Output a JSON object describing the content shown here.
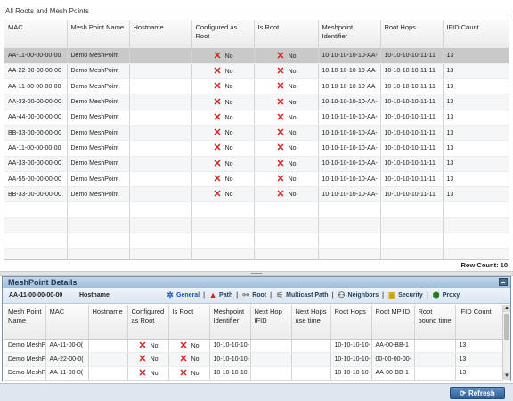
{
  "top": {
    "legend": "All Roots and Mesh Points",
    "columns": [
      "MAC",
      "Mesh Point Name",
      "Hostname",
      "Configured as Root",
      "Is Root",
      "Meshpoint Identifier",
      "Root Hops",
      "IFID Count"
    ],
    "rows": [
      {
        "mac": "AA-11-00-00-00-00",
        "name": "Demo MeshPoint",
        "host": "",
        "configured": "No",
        "is_root": "No",
        "meshpoint_id": "10-10-10-10-10-AA-",
        "root_hops": "10-10-10-10-11-11",
        "ifid": "13"
      },
      {
        "mac": "AA-22-00-00-00-00",
        "name": "Demo MeshPoint",
        "host": "",
        "configured": "No",
        "is_root": "No",
        "meshpoint_id": "10-10-10-10-10-AA-",
        "root_hops": "10-10-10-10-11-11",
        "ifid": "13"
      },
      {
        "mac": "AA-11-00-00-00-00",
        "name": "Demo MeshPoint",
        "host": "",
        "configured": "No",
        "is_root": "No",
        "meshpoint_id": "10-10-10-10-10-AA-",
        "root_hops": "10-10-10-10-11-11",
        "ifid": "13"
      },
      {
        "mac": "AA-33-00-00-00-00",
        "name": "Demo MeshPoint",
        "host": "",
        "configured": "No",
        "is_root": "No",
        "meshpoint_id": "10-10-10-10-10-AA-",
        "root_hops": "10-10-10-10-11-11",
        "ifid": "13"
      },
      {
        "mac": "AA-44-00-00-00-00",
        "name": "Demo MeshPoint",
        "host": "",
        "configured": "No",
        "is_root": "No",
        "meshpoint_id": "10-10-10-10-10-AA-",
        "root_hops": "10-10-10-10-11-11",
        "ifid": "13"
      },
      {
        "mac": "BB-33-00-00-00-00",
        "name": "Demo MeshPoint",
        "host": "",
        "configured": "No",
        "is_root": "No",
        "meshpoint_id": "10-10-10-10-10-AA-",
        "root_hops": "10-10-10-10-11-11",
        "ifid": "13"
      },
      {
        "mac": "AA-11-00-00-00-00",
        "name": "Demo MeshPoint",
        "host": "",
        "configured": "No",
        "is_root": "No",
        "meshpoint_id": "10-10-10-10-10-AA-",
        "root_hops": "10-10-10-10-11-11",
        "ifid": "13"
      },
      {
        "mac": "AA-33-00-00-00-00",
        "name": "Demo MeshPoint",
        "host": "",
        "configured": "No",
        "is_root": "No",
        "meshpoint_id": "10-10-10-10-10-AA-",
        "root_hops": "10-10-10-10-11-11",
        "ifid": "13"
      },
      {
        "mac": "AA-55-00-00-00-00",
        "name": "Demo MeshPoint",
        "host": "",
        "configured": "No",
        "is_root": "No",
        "meshpoint_id": "10-10-10-10-10-AA-",
        "root_hops": "10-10-10-10-11-11",
        "ifid": "13"
      },
      {
        "mac": "BB-33-00-00-00-00",
        "name": "Demo MeshPoint",
        "host": "",
        "configured": "No",
        "is_root": "No",
        "meshpoint_id": "10-10-10-10-10-AA-",
        "root_hops": "10-10-10-10-11-11",
        "ifid": "13"
      }
    ],
    "row_count": "Row Count: 10"
  },
  "details": {
    "title": "MeshPoint Details",
    "selected_mac": "AA-11-00-00-00-00",
    "hostname_label": "Hostname",
    "tabs": [
      {
        "label": "General",
        "icon": "general-icon"
      },
      {
        "label": "Path",
        "icon": "path-icon"
      },
      {
        "label": "Root",
        "icon": "root-icon"
      },
      {
        "label": "Multicast Path",
        "icon": "multicast-path-icon"
      },
      {
        "label": "Neighbors",
        "icon": "neighbors-icon"
      },
      {
        "label": "Security",
        "icon": "lock-icon"
      },
      {
        "label": "Proxy",
        "icon": "proxy-icon"
      }
    ],
    "columns": [
      "Mesh Point Name",
      "MAC",
      "Hostname",
      "Configured as Root",
      "Is Root",
      "Meshpoint Identifier",
      "Next Hop IFID",
      "Next Hops use time",
      "Root Hops",
      "Root MP ID",
      "Root bound time",
      "IFID Count"
    ],
    "rows": [
      {
        "name": "Demo MeshP",
        "mac": "AA-11-00-0(",
        "host": "",
        "configured": "No",
        "is_root": "No",
        "meshpoint_id": "10-10-10-10-",
        "next_hop": "",
        "next_time": "",
        "root_hops": "10-10-10-10-",
        "root_mp": "AA-00-BB-1",
        "bound": "",
        "ifid": "13"
      },
      {
        "name": "Demo MeshP",
        "mac": "AA-22-00-0(",
        "host": "",
        "configured": "No",
        "is_root": "No",
        "meshpoint_id": "10-10-10-10-",
        "next_hop": "",
        "next_time": "",
        "root_hops": "10-10-10-10-",
        "root_mp": "00-00-00-00-",
        "bound": "",
        "ifid": "13"
      },
      {
        "name": "Demo MeshP",
        "mac": "AA-11-00-0(",
        "host": "",
        "configured": "No",
        "is_root": "No",
        "meshpoint_id": "10-10-10-10-",
        "next_hop": "",
        "next_time": "",
        "root_hops": "10-10-10-10-",
        "root_mp": "AA-00-BB-1",
        "bound": "",
        "ifid": "13"
      }
    ]
  },
  "footer": {
    "refresh_label": "Refresh"
  },
  "colors": {
    "header_blue": "#9fbedb",
    "refresh_blue": "#2f5f99",
    "x_red": "#d42121",
    "selected_row": "#c9c9c9"
  }
}
